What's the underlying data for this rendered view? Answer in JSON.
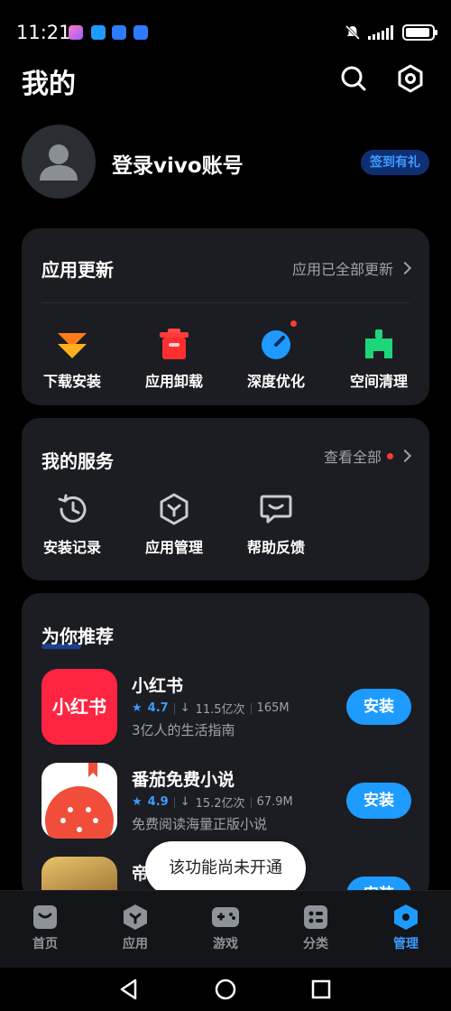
{
  "status_bar": {
    "time": "11:21"
  },
  "header": {
    "title": "我的"
  },
  "profile": {
    "login_text": "登录vivo账号",
    "checkin_label": "签到有礼"
  },
  "updates": {
    "title": "应用更新",
    "link": "应用已全部更新",
    "actions": [
      {
        "label": "下载安装",
        "icon": "download-icon"
      },
      {
        "label": "应用卸载",
        "icon": "trash-icon"
      },
      {
        "label": "深度优化",
        "icon": "optimize-icon"
      },
      {
        "label": "空间清理",
        "icon": "clean-icon"
      }
    ]
  },
  "services": {
    "title": "我的服务",
    "link": "查看全部",
    "items": [
      {
        "label": "安装记录",
        "icon": "history-icon"
      },
      {
        "label": "应用管理",
        "icon": "app-manage-icon"
      },
      {
        "label": "帮助反馈",
        "icon": "feedback-icon"
      }
    ]
  },
  "recommend": {
    "title": "为你推荐",
    "apps": [
      {
        "name": "小红书",
        "rating": "4.7",
        "downloads": "11.5亿次",
        "size": "165M",
        "desc": "3亿人的生活指南",
        "button": "安装",
        "icon_text": "小红书"
      },
      {
        "name": "番茄免费小说",
        "rating": "4.9",
        "downloads": "15.2亿次",
        "size": "67.9M",
        "desc": "免费阅读海量正版小说",
        "button": "安装"
      },
      {
        "name": "帝",
        "button": "安装"
      }
    ]
  },
  "toast": "该功能尚未开通",
  "tabs": [
    {
      "label": "首页",
      "active": false
    },
    {
      "label": "应用",
      "active": false
    },
    {
      "label": "游戏",
      "active": false
    },
    {
      "label": "分类",
      "active": false
    },
    {
      "label": "管理",
      "active": true
    }
  ],
  "colors": {
    "accent": "#1e9bff",
    "card_bg": "#1c1d22",
    "background": "#000000"
  }
}
